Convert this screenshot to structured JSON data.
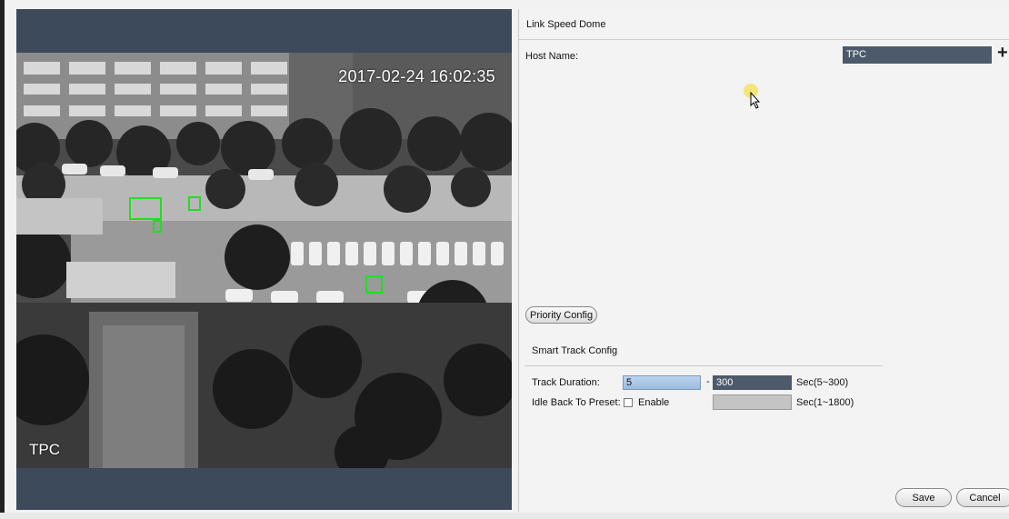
{
  "video": {
    "timestamp": "2017-02-24 16:02:35",
    "channel_name": "TPC"
  },
  "panel": {
    "title": "Link Speed Dome",
    "host_name_label": "Host Name:",
    "host_name_value": "TPC",
    "add_icon": "plus-icon",
    "priority_config_label": "Priority Config",
    "smart_track": {
      "title": "Smart Track Config",
      "track_duration_label": "Track Duration:",
      "track_duration_min": "5",
      "range_separator": "-",
      "track_duration_max": "300",
      "track_duration_unit": "Sec(5~300)",
      "idle_back_label": "Idle Back To Preset:",
      "enable_label": "Enable",
      "enable_checked": false,
      "idle_value": "",
      "idle_unit": "Sec(1~1800)"
    },
    "save_label": "Save",
    "cancel_label": "Cancel"
  },
  "colors": {
    "video_frame": "#3d4a5c",
    "selected_input": "#4d5a6c",
    "track_box": "#22dd22"
  }
}
